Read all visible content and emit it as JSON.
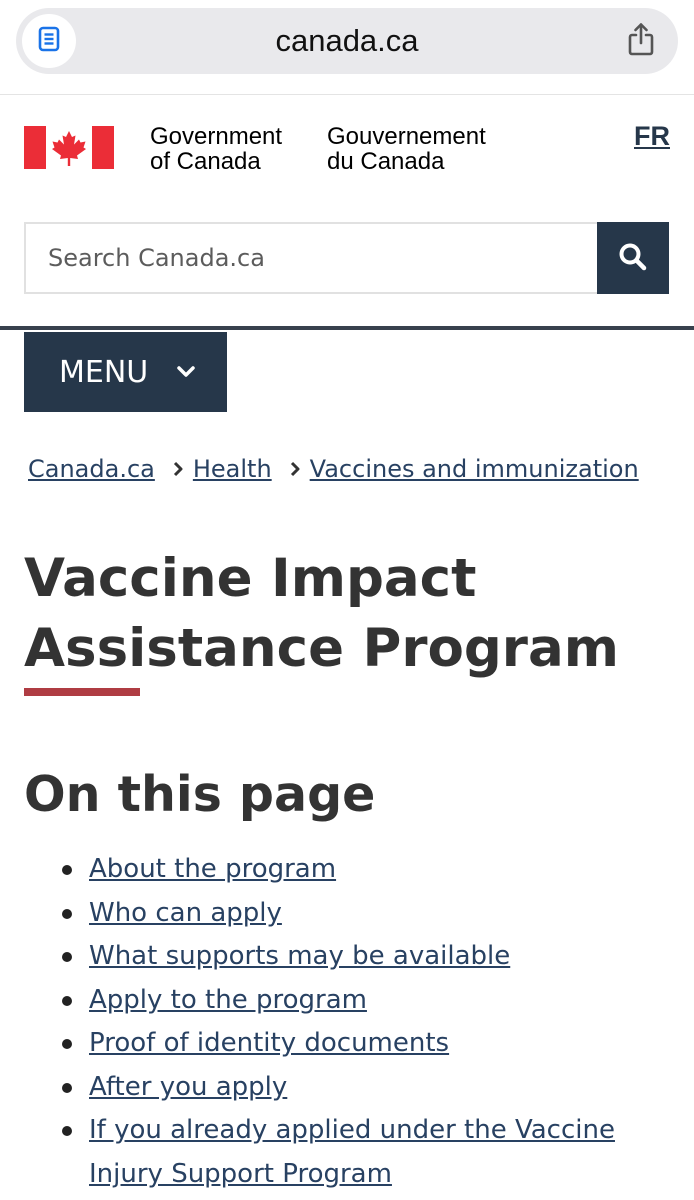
{
  "browser": {
    "url": "canada.ca",
    "reader_icon": "reader-mode-icon",
    "share_icon": "share-icon"
  },
  "header": {
    "flag_icon": "canada-flag-icon",
    "gov_en_line1": "Government",
    "gov_en_line2": "of Canada",
    "gov_fr_line1": "Gouvernement",
    "gov_fr_line2": "du Canada",
    "language_toggle": "FR"
  },
  "search": {
    "placeholder": "Search Canada.ca",
    "value": "",
    "button_icon": "search-icon"
  },
  "menu": {
    "label": "MENU",
    "icon": "chevron-down-icon"
  },
  "breadcrumb": [
    "Canada.ca",
    "Health",
    "Vaccines and immunization"
  ],
  "page": {
    "title": "Vaccine Impact Assistance Program",
    "on_this_page_heading": "On this page",
    "toc": [
      "About the program",
      "Who can apply",
      "What supports may be available",
      "Apply to the program",
      "Proof of identity documents",
      "After you apply",
      "If you already applied under the Vaccine Injury Support Program"
    ]
  },
  "colors": {
    "brand_navy": "#26374a",
    "link": "#284162",
    "accent_red": "#af3c43",
    "flag_red": "#eb2d37"
  }
}
